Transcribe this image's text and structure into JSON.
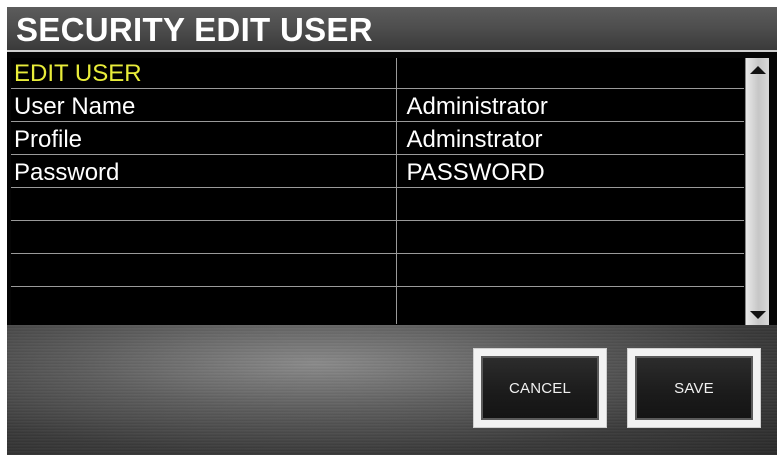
{
  "header": {
    "title": "SECURITY EDIT USER"
  },
  "table": {
    "heading": "EDIT USER",
    "rows": [
      {
        "label": "User Name",
        "value": "Administrator"
      },
      {
        "label": "Profile",
        "value": "Adminstrator"
      },
      {
        "label": "Password",
        "value": "PASSWORD"
      },
      {
        "label": "",
        "value": ""
      },
      {
        "label": "",
        "value": ""
      },
      {
        "label": "",
        "value": ""
      },
      {
        "label": "",
        "value": ""
      }
    ]
  },
  "scrollbar": {
    "up_icon": "triangle-up-icon",
    "down_icon": "triangle-down-icon"
  },
  "actions": {
    "cancel_label": "CANCEL",
    "save_label": "SAVE"
  },
  "colors": {
    "heading": "#e8ec3a",
    "text": "#ffffff",
    "background": "#000000",
    "title_bar": "#4d4d4d"
  }
}
